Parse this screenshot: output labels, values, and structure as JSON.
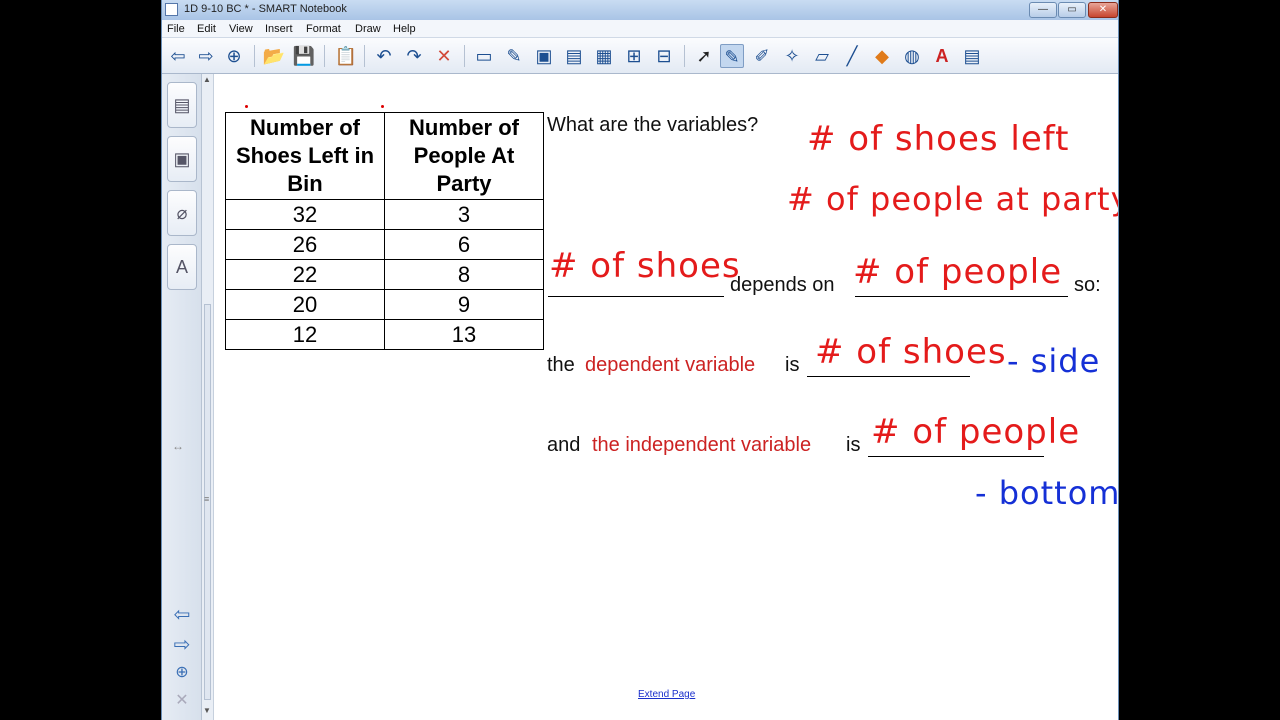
{
  "window": {
    "title": "1D 9-10 BC * - SMART Notebook",
    "controls": {
      "minimize": "—",
      "maximize": "▭",
      "close": "✕"
    }
  },
  "menu": [
    "File",
    "Edit",
    "View",
    "Insert",
    "Format",
    "Draw",
    "Help"
  ],
  "toolbar": {
    "icons": [
      "back-arrow-icon",
      "forward-arrow-icon",
      "add-page-icon",
      "open-folder-icon",
      "save-icon",
      "paste-icon",
      "undo-icon",
      "redo-icon",
      "delete-icon",
      "screen-shade-icon",
      "pens-icon",
      "full-screen-icon",
      "dual-display-icon",
      "capture-icon",
      "document-camera-icon",
      "table-icon",
      "select-icon",
      "pen-icon",
      "creative-pen-icon",
      "magic-pen-icon",
      "eraser-icon",
      "line-icon",
      "shape-icon",
      "fill-icon",
      "text-icon",
      "properties-icon"
    ],
    "glyphs": [
      "⇦",
      "⇨",
      "⊕",
      "📂",
      "💾",
      "📋",
      "↶",
      "↷",
      "✕",
      "▭",
      "✎",
      "▣",
      "▤",
      "▦",
      "⊞",
      "⊟",
      "➚",
      "✎",
      "✐",
      "✧",
      "▱",
      "╱",
      "◆",
      "◍",
      "A",
      "▤"
    ]
  },
  "sidebar": {
    "tabs": [
      "page-sorter-tab",
      "gallery-tab",
      "attachments-tab",
      "properties-tab"
    ],
    "tab_glyphs": [
      "▤",
      "▣",
      "⌀",
      "A"
    ],
    "resize_glyph": "↔",
    "nav_glyphs": {
      "prev": "⇦",
      "next": "⇨",
      "add": "⊕",
      "delete": "✕"
    }
  },
  "table": {
    "headers": [
      "Number of Shoes Left in Bin",
      "Number of People At Party"
    ],
    "rows": [
      [
        "32",
        "3"
      ],
      [
        "26",
        "6"
      ],
      [
        "22",
        "8"
      ],
      [
        "20",
        "9"
      ],
      [
        "12",
        "13"
      ]
    ]
  },
  "content": {
    "question": "What are the variables?",
    "depends_on": "depends on",
    "so": "so:",
    "the": "the",
    "dependent_variable": "dependent variable",
    "is": "is",
    "and": "and",
    "independent_variable": "the independent variable",
    "is2": "is"
  },
  "handwriting": {
    "var1": "# of shoes left",
    "var2": "# of people at party",
    "blank1": "# of shoes",
    "blank2": "# of people",
    "dependent": "# of shoes",
    "side": "- side",
    "independent": "# of people",
    "bottom": "- bottom"
  },
  "extend_page": "Extend Page",
  "colors": {
    "ink_red": "#e41b1b",
    "ink_blue": "#1530d6",
    "label_red": "#cc2222"
  }
}
